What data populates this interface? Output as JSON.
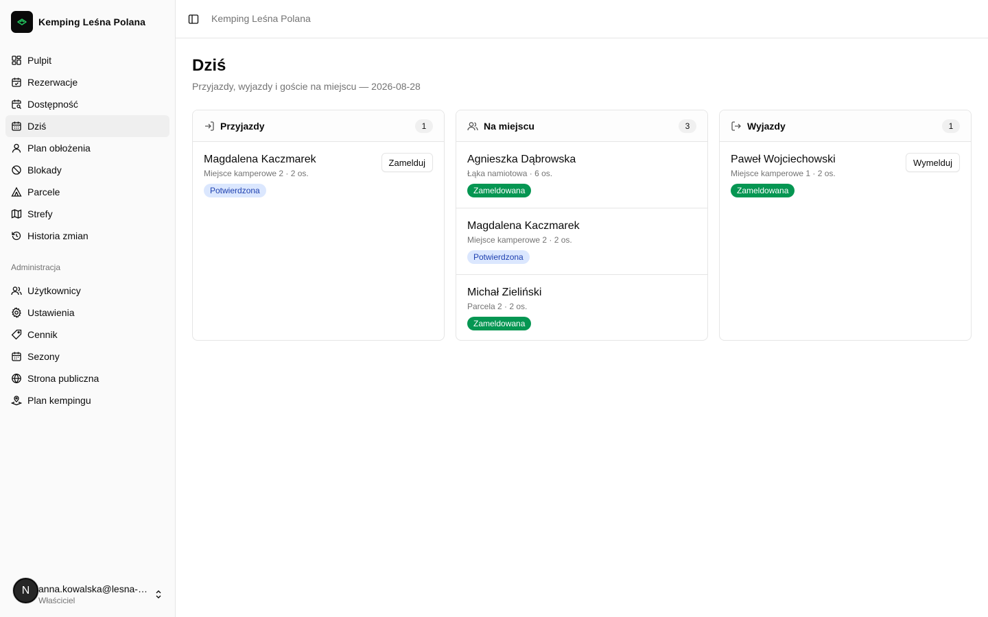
{
  "app": {
    "name": "Kemping Leśna Polana"
  },
  "sidebar": {
    "main_items": [
      {
        "label": "Pulpit",
        "icon": "dashboard-icon"
      },
      {
        "label": "Rezerwacje",
        "icon": "calendar-check-icon"
      },
      {
        "label": "Dostępność",
        "icon": "calendar-search-icon"
      },
      {
        "label": "Dziś",
        "icon": "calendar-icon",
        "active": true
      },
      {
        "label": "Plan obłożenia",
        "icon": "users-icon"
      },
      {
        "label": "Blokady",
        "icon": "ban-icon"
      },
      {
        "label": "Parcele",
        "icon": "tent-icon"
      },
      {
        "label": "Strefy",
        "icon": "map-icon"
      },
      {
        "label": "Historia zmian",
        "icon": "history-icon"
      }
    ],
    "admin_label": "Administracja",
    "admin_items": [
      {
        "label": "Użytkownicy",
        "icon": "users-icon"
      },
      {
        "label": "Ustawienia",
        "icon": "gear-icon"
      },
      {
        "label": "Cennik",
        "icon": "tag-icon"
      },
      {
        "label": "Sezony",
        "icon": "calendar-icon"
      },
      {
        "label": "Strona publiczna",
        "icon": "globe-icon"
      },
      {
        "label": "Plan kempingu",
        "icon": "map-pin-icon"
      }
    ],
    "user": {
      "avatar_letter": "N",
      "email": "anna.kowalska@lesna-polana.pl",
      "role": "Właściciel"
    }
  },
  "header": {
    "breadcrumb": "Kemping Leśna Polana"
  },
  "page": {
    "title": "Dziś",
    "subtitle": "Przyjazdy, wyjazdy i goście na miejscu — 2026-08-28"
  },
  "columns": [
    {
      "title": "Przyjazdy",
      "count": "1",
      "icon": "log-in-icon",
      "entries": [
        {
          "name": "Magdalena Kaczmarek",
          "place": "Miejsce kamperowe 2",
          "persons": "2 os.",
          "status": "Potwierdzona",
          "status_type": "confirmed",
          "action": "Zamelduj"
        }
      ]
    },
    {
      "title": "Na miejscu",
      "count": "3",
      "icon": "users-icon",
      "entries": [
        {
          "name": "Agnieszka Dąbrowska",
          "place": "Łąka namiotowa",
          "persons": "6 os.",
          "status": "Zameldowana",
          "status_type": "checked-in"
        },
        {
          "name": "Magdalena Kaczmarek",
          "place": "Miejsce kamperowe 2",
          "persons": "2 os.",
          "status": "Potwierdzona",
          "status_type": "confirmed"
        },
        {
          "name": "Michał Zieliński",
          "place": "Parcela 2",
          "persons": "2 os.",
          "status": "Zameldowana",
          "status_type": "checked-in"
        }
      ]
    },
    {
      "title": "Wyjazdy",
      "count": "1",
      "icon": "log-out-icon",
      "entries": [
        {
          "name": "Paweł Wojciechowski",
          "place": "Miejsce kamperowe 1",
          "persons": "2 os.",
          "status": "Zameldowana",
          "status_type": "checked-in",
          "action": "Wymelduj"
        }
      ]
    }
  ],
  "colors": {
    "confirmed_bg": "#dbe7fe",
    "confirmed_text": "#1e40af",
    "checked_in_bg": "#059652",
    "accent_logo": "#22c55e"
  }
}
